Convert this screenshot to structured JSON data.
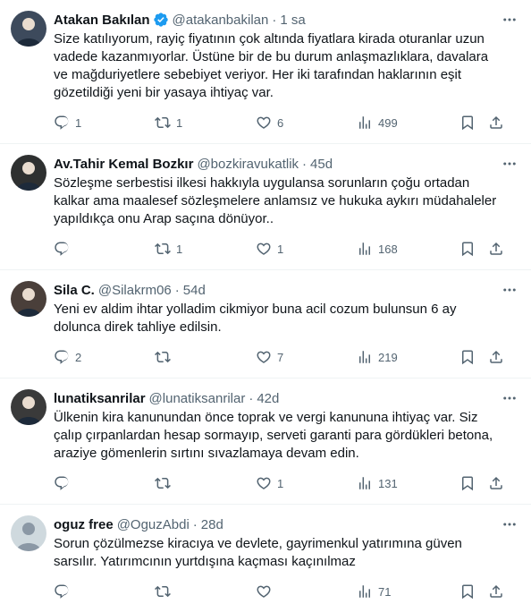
{
  "tweets": [
    {
      "name": "Atakan Bakılan",
      "verified": true,
      "handle": "@atakanbakilan",
      "time": "1 sa",
      "text": "Size katılıyorum, rayiç fiyatının çok altında fiyatlara kirada oturanlar uzun vadede kazanmıyorlar. Üstüne bir de bu durum anlaşmazlıklara, davalara ve mağduriyetlere sebebiyet veriyor. Her iki tarafından haklarının eşit gözetildiği yeni bir yasaya ihtiyaç var.",
      "replies": "1",
      "retweets": "1",
      "likes": "6",
      "views": "499",
      "avatar_color": "#3d4a5c"
    },
    {
      "name": "Av.Tahir Kemal Bozkır",
      "verified": false,
      "handle": "@bozkiravukatlik",
      "time": "45d",
      "text": "Sözleşme serbestisi ilkesi hakkıyla uygulansa sorunların çoğu ortadan kalkar ama maalesef sözleşmelere anlamsız ve hukuka aykırı müdahaleler yapıldıkça onu Arap saçına dönüyor..",
      "replies": "",
      "retweets": "1",
      "likes": "1",
      "views": "168",
      "avatar_color": "#2e3030"
    },
    {
      "name": "Sila C.",
      "verified": false,
      "handle": "@Silakrm06",
      "time": "54d",
      "text": "Yeni ev aldim ihtar yolladim cikmiyor buna acil cozum bulunsun 6 ay dolunca direk tahliye edilsin.",
      "replies": "2",
      "retweets": "",
      "likes": "7",
      "views": "219",
      "avatar_color": "#4a3f3a"
    },
    {
      "name": "lunatiksanrilar",
      "verified": false,
      "handle": "@lunatiksanrilar",
      "time": "42d",
      "text": "Ülkenin kira kanunundan önce toprak ve vergi kanununa ihtiyaç var. Siz çalıp çırpanlardan hesap sormayıp, serveti garanti para gördükleri betona, araziye gömenlerin sırtını sıvazlamaya devam edin.",
      "replies": "",
      "retweets": "",
      "likes": "1",
      "views": "131",
      "avatar_color": "#3a3a3a"
    },
    {
      "name": "oguz free",
      "verified": false,
      "handle": "@OguzAbdi",
      "time": "28d",
      "text": "Sorun çözülmezse kiracıya ve devlete, gayrimenkul yatırımına güven sarsılır. Yatırımcının yurtdışına kaçması kaçınılmaz",
      "replies": "",
      "retweets": "",
      "likes": "",
      "views": "71",
      "avatar_color": "#cfd9de"
    }
  ],
  "separator": "·",
  "icons": {
    "reply": "reply-icon",
    "retweet": "retweet-icon",
    "like": "like-icon",
    "views": "views-icon",
    "bookmark": "bookmark-icon",
    "share": "share-icon",
    "more": "more-icon",
    "verified": "verified-badge-icon"
  },
  "colors": {
    "text": "#0f1419",
    "secondary": "#536471",
    "verified": "#1d9bf0",
    "divider": "#eff3f4"
  }
}
